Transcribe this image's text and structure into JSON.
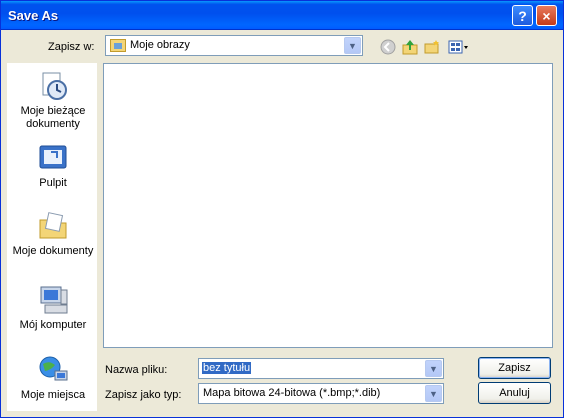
{
  "window": {
    "title": "Save As"
  },
  "titlebar": {
    "help_label": "?",
    "close_label": "×"
  },
  "toolbar": {
    "save_in_label": "Zapisz w:",
    "save_in_value": "Moje obrazy",
    "icons": [
      "back-icon",
      "up-folder-icon",
      "new-folder-icon",
      "views-menu-icon"
    ]
  },
  "places": [
    {
      "label": "Moje bieżące dokumenty",
      "icon": "recent-documents-icon"
    },
    {
      "label": "Pulpit",
      "icon": "desktop-icon"
    },
    {
      "label": "Moje dokumenty",
      "icon": "my-documents-icon"
    },
    {
      "label": "Mój komputer",
      "icon": "my-computer-icon"
    },
    {
      "label": "Moje miejsca",
      "icon": "network-places-icon"
    }
  ],
  "form": {
    "filename_label": "Nazwa pliku:",
    "filename_value": "bez tytułu",
    "filetype_label": "Zapisz jako typ:",
    "filetype_value": "Mapa bitowa 24-bitowa (*.bmp;*.dib)"
  },
  "buttons": {
    "save": "Zapisz",
    "cancel": "Anuluj"
  }
}
